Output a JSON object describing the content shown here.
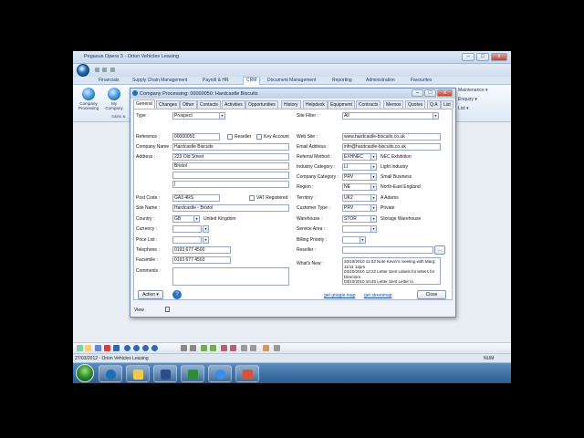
{
  "app": {
    "title": "Pegasus Opera 3 - Orion Vehicles Leasing",
    "window_controls": {
      "min": "–",
      "max": "□",
      "close": "x"
    }
  },
  "ribbon": {
    "tabs": [
      "Financials",
      "Supply Chain Management",
      "Payroll & HR",
      "CRM",
      "Document Management",
      "Reporting",
      "Administration",
      "Favourites"
    ],
    "active_tab": "CRM",
    "buttons": [
      {
        "label": "Company Processing"
      },
      {
        "label": "My Company"
      }
    ],
    "group_label": "Sales &",
    "right_items": [
      "Maintenance ▾",
      "Enquiry ▾",
      "List ▾"
    ]
  },
  "dialog": {
    "title": "Company Processing: 00000050: Hardcastle Biscuits",
    "tabs": [
      "General",
      "Changes",
      "Other",
      "Contacts",
      "Activities",
      "Opportunities",
      "History",
      "Helpdesk",
      "Equipment",
      "Contracts",
      "Memos",
      "Quotes",
      "Q.A",
      "List"
    ],
    "active_tab": "General",
    "left": {
      "type_label": "Type :",
      "type_value": "Prospect",
      "reference_label": "Reference :",
      "reference_value": "00000050",
      "reseller_label": "Reseller",
      "key_account_label": "Key Account",
      "company_name_label": "Company Name :",
      "company_name_value": "Hardcastle Biscuits",
      "address_label": "Address :",
      "address_lines": [
        "223 Old Street",
        "Bristol",
        "",
        "|"
      ],
      "post_code_label": "Post Code :",
      "post_code_value": "GA3 4RS",
      "vat_label": "VAT Registered",
      "site_name_label": "Site Name :",
      "site_name_value": "Hardcastle - Bristol",
      "country_label": "Country :",
      "country_code": "GB",
      "country_name": "United Kingdom",
      "currency_label": "Currency :",
      "currency_value": "",
      "price_list_label": "Price List :",
      "price_list_value": "",
      "telephone_label": "Telephone :",
      "telephone_value": "0193 677 4500",
      "facsimile_label": "Facsimile :",
      "facsimile_value": "0193 677 4503",
      "comments_label": "Comments :"
    },
    "right": {
      "site_filter_label": "Site Filter :",
      "site_filter_value": "All",
      "web_site_label": "Web Site :",
      "web_site_value": "www.hardcastle-biscuits.co.uk",
      "email_label": "Email Address :",
      "email_value": "info@hardcastle-biscuits.co.uk",
      "referral_label": "Referral Method :",
      "referral_code": "EXHNEC",
      "referral_desc": "NEC Exhibition",
      "industry_label": "Industry Category :",
      "industry_code": "LI",
      "industry_desc": "Light Industry",
      "company_cat_label": "Company Category :",
      "company_cat_code": "PRV",
      "company_cat_desc": "Small Business",
      "region_label": "Region :",
      "region_code": "NE",
      "region_desc": "North-East England",
      "territory_label": "Territory :",
      "territory_code": "UK2",
      "territory_desc": "A Adams",
      "customer_type_label": "Customer Type :",
      "customer_type_code": "PRV",
      "customer_type_desc": "Private",
      "warehouse_label": "Warehouse :",
      "warehouse_code": "STOR",
      "warehouse_desc": "Storage Warehouse",
      "service_area_label": "Service Area :",
      "billing_priority_label": "Billing Priority :",
      "reseller_label": "Reseller :",
      "reseller_button": "...",
      "whats_new_label": "What's New :",
      "whats_new_entries": [
        "20/10/2010 11:02 Note Kevin's meeting with Marg: 11/11 12pm",
        "03/10/2010 13:22 Letter Sent Labels for letters for Directors",
        "03/10/2010 10:45 Letter Sent Letter to"
      ]
    },
    "footer": {
      "action_label": "Action",
      "help_icon": "?",
      "google_map_link": "get google map",
      "streetmap_link": "get streetmap",
      "close_label": "Close",
      "view_label": "View"
    }
  },
  "statusbar": {
    "date_company": "27/03/2012 - Orion Vehicles Leasing",
    "num": "NUM"
  }
}
